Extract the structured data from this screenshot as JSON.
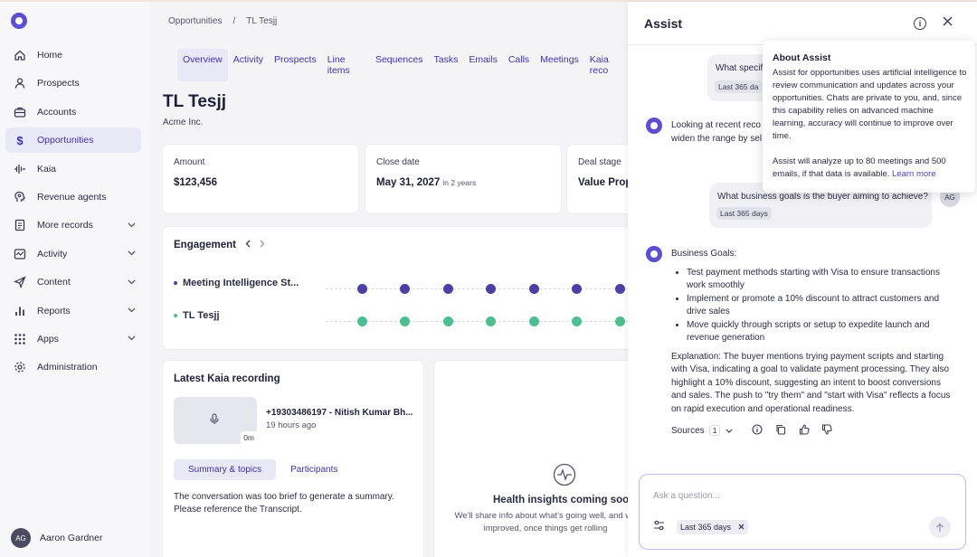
{
  "sidebar": {
    "items": [
      {
        "label": "Home",
        "icon": "home-icon"
      },
      {
        "label": "Prospects",
        "icon": "person-icon"
      },
      {
        "label": "Accounts",
        "icon": "briefcase-icon"
      },
      {
        "label": "Opportunities",
        "icon": "dollar-icon",
        "active": true
      },
      {
        "label": "Kaia",
        "icon": "waveform-icon"
      },
      {
        "label": "Revenue agents",
        "icon": "agent-icon"
      },
      {
        "label": "More records",
        "icon": "records-icon",
        "expandable": true
      },
      {
        "label": "Activity",
        "icon": "activity-icon",
        "expandable": true
      },
      {
        "label": "Content",
        "icon": "send-icon",
        "expandable": true
      },
      {
        "label": "Reports",
        "icon": "bar-chart-icon",
        "expandable": true
      },
      {
        "label": "Apps",
        "icon": "grid-icon",
        "expandable": true
      },
      {
        "label": "Administration",
        "icon": "gear-icon"
      }
    ],
    "user": {
      "initials": "AG",
      "name": "Aaron Gardner"
    }
  },
  "breadcrumb": {
    "parent": "Opportunities",
    "sep": "/",
    "current": "TL Tesjj"
  },
  "tabs": [
    "Overview",
    "Activity",
    "Prospects",
    "Line items",
    "Sequences",
    "Tasks",
    "Emails",
    "Calls",
    "Meetings",
    "Kaia reco"
  ],
  "opportunity": {
    "title": "TL Tesjj",
    "company": "Acme Inc."
  },
  "cards": {
    "amount": {
      "label": "Amount",
      "value": "$123,456"
    },
    "close_date": {
      "label": "Close date",
      "value": "May 31, 2027",
      "note": "in 2 years"
    },
    "deal_stage": {
      "label": "Deal stage",
      "value": "Value Prop"
    }
  },
  "engagement": {
    "title": "Engagement",
    "rows": [
      {
        "label": "Meeting Intelligence St...",
        "color": "#4b3fa8"
      },
      {
        "label": "TL Tesjj",
        "color": "#4dbf8e"
      }
    ]
  },
  "recording": {
    "title": "Latest Kaia recording",
    "name": "+19303486197 - Nitish Kumar Bh...",
    "time": "19 hours ago",
    "duration": "0m",
    "tab_summary": "Summary & topics",
    "tab_participants": "Participants",
    "summary": "The conversation was too brief to generate a summary. Please reference the Transcript."
  },
  "health": {
    "title": "Health insights coming soo",
    "line1": "We'll share info about what's going well, and wh",
    "line2": "improved, once things get rolling"
  },
  "assist": {
    "title": "Assist",
    "msg1": {
      "text": "What specif",
      "chip": "Last 365 da"
    },
    "ai1": {
      "line1": "Looking at recent reco",
      "line2": "widen the range by sel"
    },
    "msg2": {
      "text": "What business goals is the buyer aiming to achieve?",
      "chip": "Last 365 days",
      "initials": "AG"
    },
    "ai2": {
      "heading": "Business Goals:",
      "bullets": [
        "Test payment methods starting with Visa to ensure transactions work smoothly",
        "Implement or promote a 10% discount to attract customers and drive sales",
        "Move quickly through scripts or setup to expedite launch and revenue generation"
      ],
      "explanation": "Explanation: The buyer mentions trying payment scripts and starting with Visa, indicating a goal to validate payment processing. They also highlight a 10% discount, suggesting an intent to boost conversions and sales. The push to \"try them\" and \"start with Visa\" reflects a focus on rapid execution and operational readiness."
    },
    "sources_label": "Sources",
    "sources_count": "1",
    "input": {
      "placeholder": "Ask a question...",
      "filter": "Last 365 days"
    }
  },
  "tooltip": {
    "title": "About Assist",
    "body1": "Assist for opportunities uses artificial intelligence to review communication and updates across your opportunities. Chats are private to you, and, since this capability relies on advanced machine learning, accuracy will continue to improve over time.",
    "body2": "Assist will analyze up to 80 meetings and 500 emails, if that data is available.",
    "learn_more": "Learn more"
  },
  "colors": {
    "accent": "#5b4fd6",
    "active_bg": "#e9e8f7",
    "meeting_dot": "#4b3fa8",
    "contact_dot": "#4dbf8e"
  }
}
